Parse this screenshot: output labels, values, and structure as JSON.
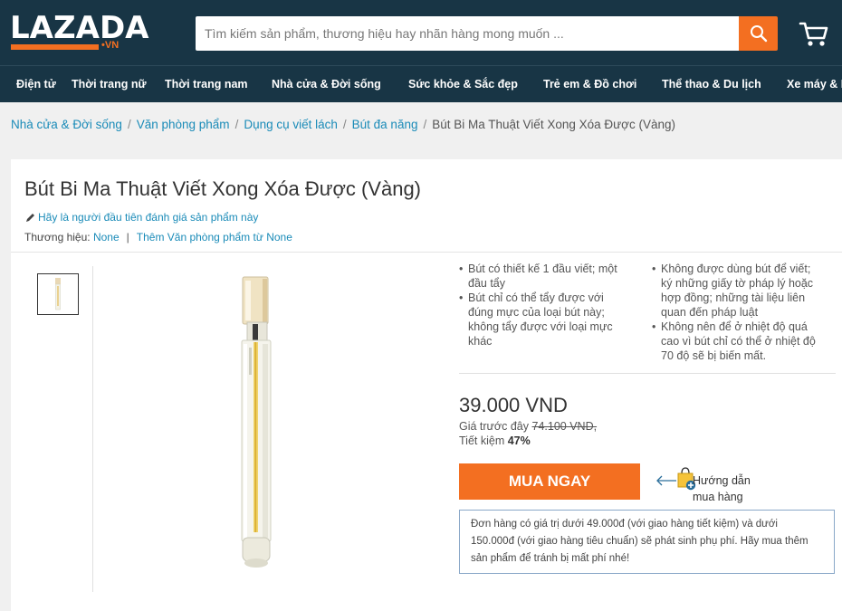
{
  "header": {
    "logo_text": "LAZADA",
    "logo_suffix": "•VN",
    "search_placeholder": "Tìm kiếm sản phẩm, thương hiệu hay nhãn hàng mong muốn ...",
    "colors": {
      "header_bg": "#183545",
      "accent": "#f36f21",
      "link": "#1a8bb8"
    },
    "icons": {
      "search": "search-icon",
      "cart": "cart-icon"
    }
  },
  "nav": {
    "items": [
      "Điện tử",
      "Thời trang nữ",
      "Thời trang nam",
      "Nhà cửa & Đời sống",
      "Sức khỏe & Sắc đẹp",
      "Trẻ em & Đồ chơi",
      "Thể thao & Du lịch",
      "Xe máy & B"
    ]
  },
  "breadcrumb": {
    "items": [
      "Nhà cửa & Đời sống",
      "Văn phòng phẩm",
      "Dụng cụ viết lách",
      "Bút đa năng"
    ],
    "separator": "/",
    "current": "Bút Bi Ma Thuật Viết Xong Xóa Được (Vàng)"
  },
  "product": {
    "title": "Bút Bi Ma Thuật Viết Xong Xóa Được (Vàng)",
    "review_prompt": "Hãy là người đầu tiên đánh giá sản phẩm này",
    "brand_label": "Thương hiệu:",
    "brand_value": "None",
    "brand_separator": "|",
    "brand_more": "Thêm Văn phòng phẩm từ None",
    "features_left": [
      "Bút có thiết kế 1 đầu viết; một đầu tẩy",
      "Bút chỉ có thể tẩy được với đúng mực của loại bút này; không tẩy được với loại mực khác"
    ],
    "features_right": [
      "Không được dùng bút để viết; ký những giấy tờ pháp lý hoặc hợp đồng; những tài liệu liên quan đến pháp luật",
      "Không nên để ở nhiệt độ quá cao vì bút chỉ có thể ở nhiệt độ 70 độ sẽ bị biến mất."
    ],
    "price": "39.000 VND",
    "previous_price_label": "Giá trước đây",
    "previous_price": "74.100 VND,",
    "saving_label": "Tiết kiệm",
    "saving_value": "47%",
    "buy_label": "MUA NGAY",
    "guide_line1": "Hướng dẫn",
    "guide_line2": "mua hàng",
    "notice": "Đơn hàng có giá trị dưới 49.000đ (với giao hàng tiết kiệm) và dưới 150.000đ (với giao hàng tiêu chuẩn) sẽ phát sinh phụ phí. Hãy mua thêm sản phẩm để tránh bị mất phí nhé!"
  }
}
